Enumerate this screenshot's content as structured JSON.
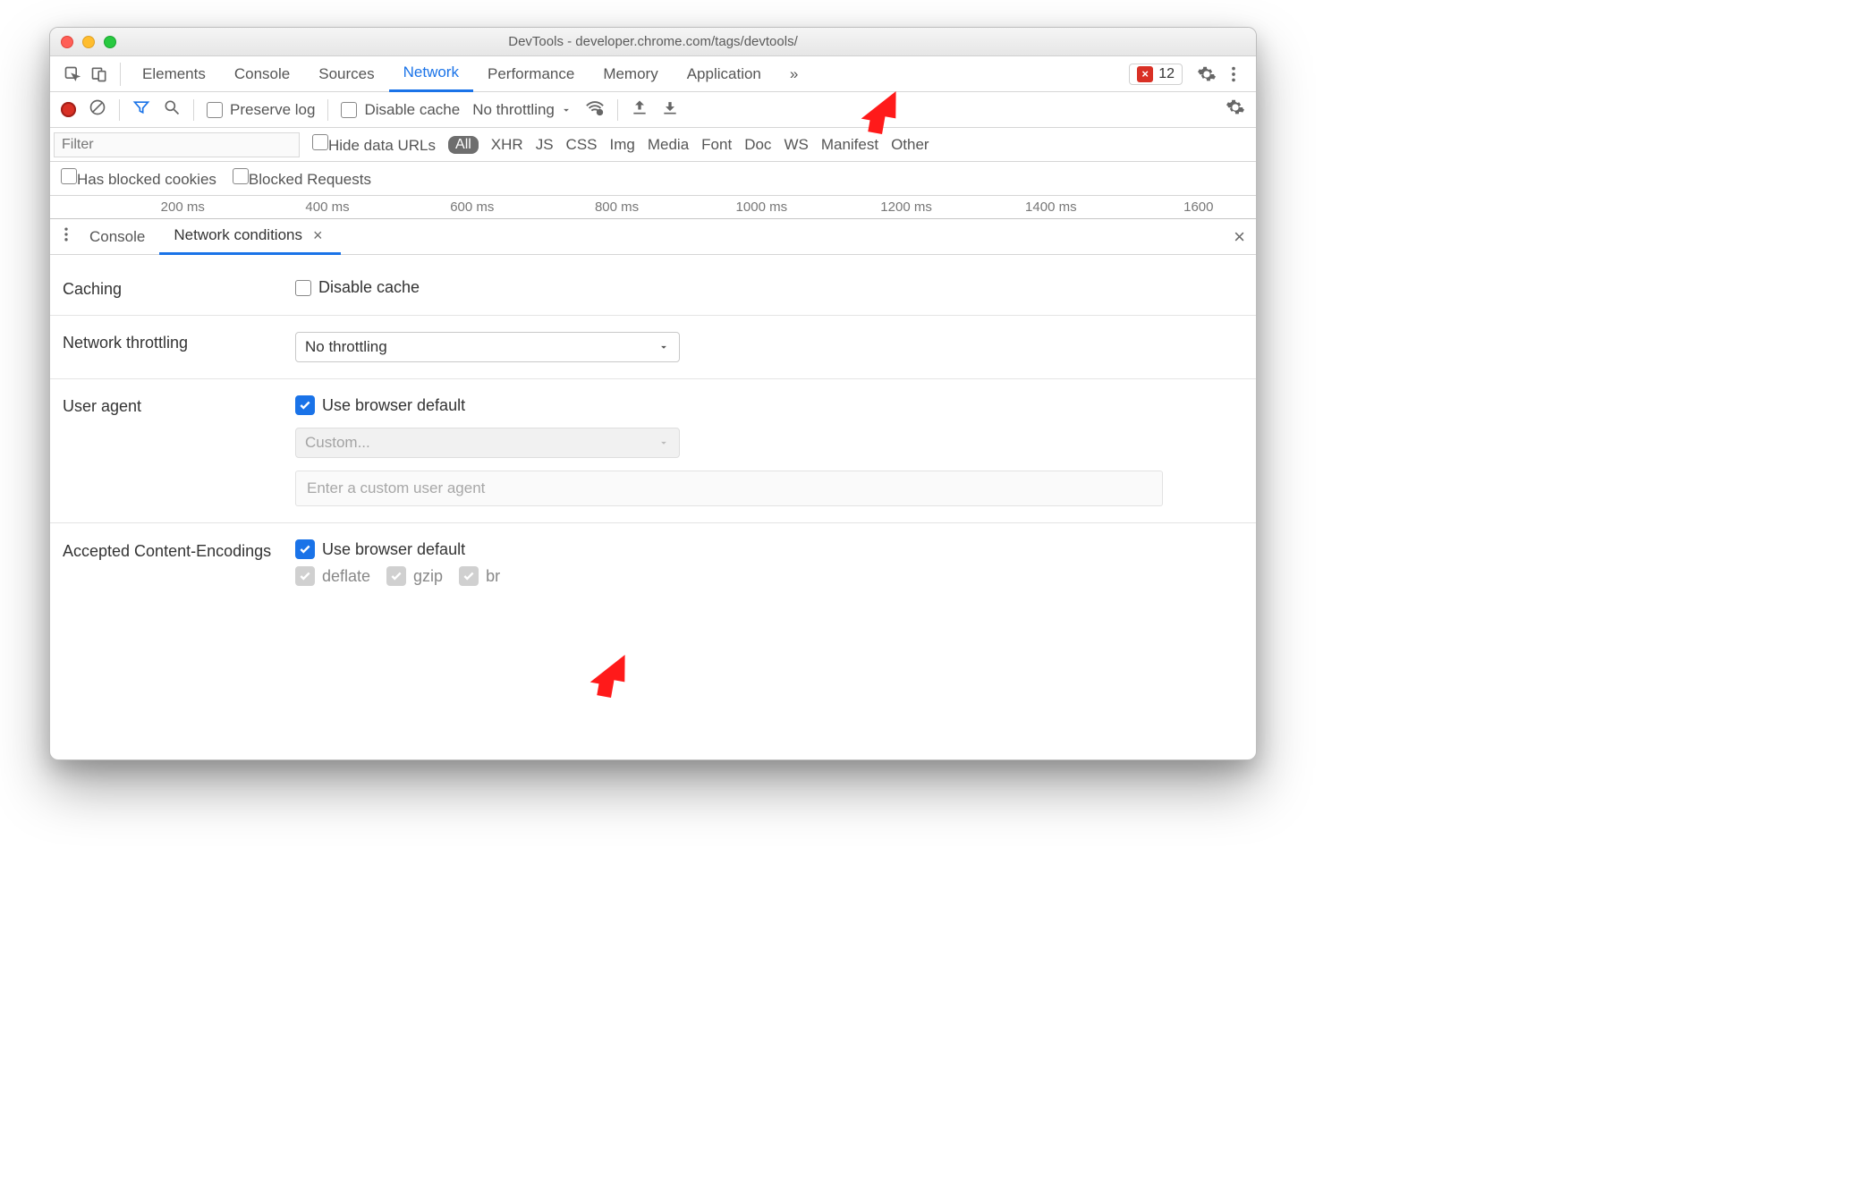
{
  "window": {
    "title": "DevTools - developer.chrome.com/tags/devtools/"
  },
  "mainTabs": {
    "items": [
      "Elements",
      "Console",
      "Sources",
      "Network",
      "Performance",
      "Memory",
      "Application"
    ],
    "activeIndex": 3,
    "overflow": "»",
    "errorCount": "12"
  },
  "networkToolbar": {
    "preserve_log": "Preserve log",
    "disable_cache": "Disable cache",
    "throttling": "No throttling"
  },
  "filterBar": {
    "placeholder": "Filter",
    "hide_urls": "Hide data URLs",
    "types": [
      "All",
      "XHR",
      "JS",
      "CSS",
      "Img",
      "Media",
      "Font",
      "Doc",
      "WS",
      "Manifest",
      "Other"
    ]
  },
  "blockedBar": {
    "has_cookies": "Has blocked cookies",
    "blocked_req": "Blocked Requests"
  },
  "timelineTicks": [
    "200 ms",
    "400 ms",
    "600 ms",
    "800 ms",
    "1000 ms",
    "1200 ms",
    "1400 ms",
    "1600 ms"
  ],
  "drawer": {
    "tabs": {
      "console": "Console",
      "netcond": "Network conditions"
    },
    "sections": {
      "caching": {
        "label": "Caching",
        "disable_cache": "Disable cache"
      },
      "throttling": {
        "label": "Network throttling",
        "value": "No throttling"
      },
      "useragent": {
        "label": "User agent",
        "use_default": "Use browser default",
        "custom_placeholder": "Custom...",
        "input_placeholder": "Enter a custom user agent"
      },
      "encodings": {
        "label": "Accepted Content-Encodings",
        "use_default": "Use browser default",
        "items": [
          "deflate",
          "gzip",
          "br"
        ]
      }
    }
  }
}
